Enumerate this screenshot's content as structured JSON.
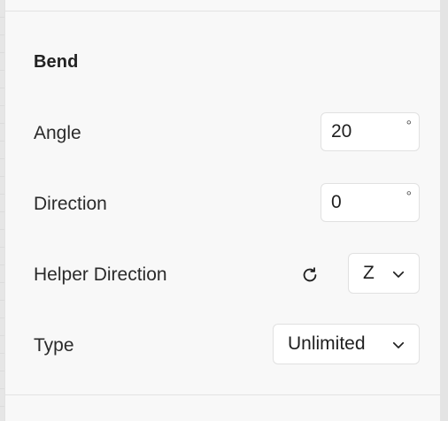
{
  "section": {
    "title": "Bend"
  },
  "angle": {
    "label": "Angle",
    "value": "20",
    "unit": "°"
  },
  "direction": {
    "label": "Direction",
    "value": "0",
    "unit": "°"
  },
  "helper_direction": {
    "label": "Helper Direction",
    "value": "Z",
    "reset_icon": "refresh-icon",
    "chevron_icon": "chevron-down-icon"
  },
  "type": {
    "label": "Type",
    "value": "Unlimited",
    "chevron_icon": "chevron-down-icon"
  },
  "colors": {
    "panel_background": "#f8f8f8",
    "field_background": "#ffffff",
    "field_border": "#e1e1e1",
    "text": "#1f1f1f"
  }
}
